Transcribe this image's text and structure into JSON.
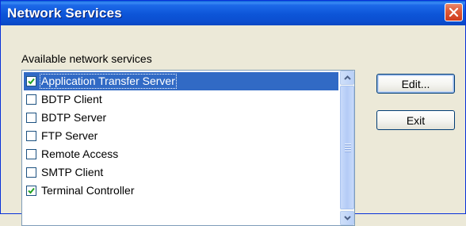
{
  "window": {
    "title": "Network Services"
  },
  "list": {
    "label": "Available network services",
    "items": [
      {
        "label": "Application Transfer Server",
        "checked": true,
        "selected": true
      },
      {
        "label": "BDTP Client",
        "checked": false,
        "selected": false
      },
      {
        "label": "BDTP Server",
        "checked": false,
        "selected": false
      },
      {
        "label": "FTP Server",
        "checked": false,
        "selected": false
      },
      {
        "label": "Remote Access",
        "checked": false,
        "selected": false
      },
      {
        "label": "SMTP Client",
        "checked": false,
        "selected": false
      },
      {
        "label": "Terminal Controller",
        "checked": true,
        "selected": false
      }
    ]
  },
  "buttons": {
    "edit_label": "Edit...",
    "exit_label": "Exit"
  },
  "colors": {
    "titlebar": "#0a4fd0",
    "selection": "#316ac5",
    "close_button": "#d8502f"
  }
}
